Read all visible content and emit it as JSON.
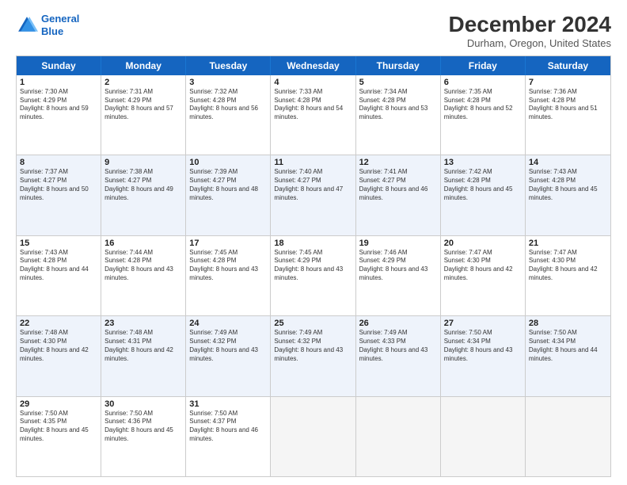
{
  "header": {
    "logo_line1": "General",
    "logo_line2": "Blue",
    "month_title": "December 2024",
    "location": "Durham, Oregon, United States"
  },
  "days_of_week": [
    "Sunday",
    "Monday",
    "Tuesday",
    "Wednesday",
    "Thursday",
    "Friday",
    "Saturday"
  ],
  "weeks": [
    [
      {
        "day": "1",
        "sunrise": "7:30 AM",
        "sunset": "4:29 PM",
        "daylight": "8 hours and 59 minutes."
      },
      {
        "day": "2",
        "sunrise": "7:31 AM",
        "sunset": "4:29 PM",
        "daylight": "8 hours and 57 minutes."
      },
      {
        "day": "3",
        "sunrise": "7:32 AM",
        "sunset": "4:28 PM",
        "daylight": "8 hours and 56 minutes."
      },
      {
        "day": "4",
        "sunrise": "7:33 AM",
        "sunset": "4:28 PM",
        "daylight": "8 hours and 54 minutes."
      },
      {
        "day": "5",
        "sunrise": "7:34 AM",
        "sunset": "4:28 PM",
        "daylight": "8 hours and 53 minutes."
      },
      {
        "day": "6",
        "sunrise": "7:35 AM",
        "sunset": "4:28 PM",
        "daylight": "8 hours and 52 minutes."
      },
      {
        "day": "7",
        "sunrise": "7:36 AM",
        "sunset": "4:28 PM",
        "daylight": "8 hours and 51 minutes."
      }
    ],
    [
      {
        "day": "8",
        "sunrise": "7:37 AM",
        "sunset": "4:27 PM",
        "daylight": "8 hours and 50 minutes."
      },
      {
        "day": "9",
        "sunrise": "7:38 AM",
        "sunset": "4:27 PM",
        "daylight": "8 hours and 49 minutes."
      },
      {
        "day": "10",
        "sunrise": "7:39 AM",
        "sunset": "4:27 PM",
        "daylight": "8 hours and 48 minutes."
      },
      {
        "day": "11",
        "sunrise": "7:40 AM",
        "sunset": "4:27 PM",
        "daylight": "8 hours and 47 minutes."
      },
      {
        "day": "12",
        "sunrise": "7:41 AM",
        "sunset": "4:27 PM",
        "daylight": "8 hours and 46 minutes."
      },
      {
        "day": "13",
        "sunrise": "7:42 AM",
        "sunset": "4:28 PM",
        "daylight": "8 hours and 45 minutes."
      },
      {
        "day": "14",
        "sunrise": "7:43 AM",
        "sunset": "4:28 PM",
        "daylight": "8 hours and 45 minutes."
      }
    ],
    [
      {
        "day": "15",
        "sunrise": "7:43 AM",
        "sunset": "4:28 PM",
        "daylight": "8 hours and 44 minutes."
      },
      {
        "day": "16",
        "sunrise": "7:44 AM",
        "sunset": "4:28 PM",
        "daylight": "8 hours and 43 minutes."
      },
      {
        "day": "17",
        "sunrise": "7:45 AM",
        "sunset": "4:28 PM",
        "daylight": "8 hours and 43 minutes."
      },
      {
        "day": "18",
        "sunrise": "7:45 AM",
        "sunset": "4:29 PM",
        "daylight": "8 hours and 43 minutes."
      },
      {
        "day": "19",
        "sunrise": "7:46 AM",
        "sunset": "4:29 PM",
        "daylight": "8 hours and 43 minutes."
      },
      {
        "day": "20",
        "sunrise": "7:47 AM",
        "sunset": "4:30 PM",
        "daylight": "8 hours and 42 minutes."
      },
      {
        "day": "21",
        "sunrise": "7:47 AM",
        "sunset": "4:30 PM",
        "daylight": "8 hours and 42 minutes."
      }
    ],
    [
      {
        "day": "22",
        "sunrise": "7:48 AM",
        "sunset": "4:30 PM",
        "daylight": "8 hours and 42 minutes."
      },
      {
        "day": "23",
        "sunrise": "7:48 AM",
        "sunset": "4:31 PM",
        "daylight": "8 hours and 42 minutes."
      },
      {
        "day": "24",
        "sunrise": "7:49 AM",
        "sunset": "4:32 PM",
        "daylight": "8 hours and 43 minutes."
      },
      {
        "day": "25",
        "sunrise": "7:49 AM",
        "sunset": "4:32 PM",
        "daylight": "8 hours and 43 minutes."
      },
      {
        "day": "26",
        "sunrise": "7:49 AM",
        "sunset": "4:33 PM",
        "daylight": "8 hours and 43 minutes."
      },
      {
        "day": "27",
        "sunrise": "7:50 AM",
        "sunset": "4:34 PM",
        "daylight": "8 hours and 43 minutes."
      },
      {
        "day": "28",
        "sunrise": "7:50 AM",
        "sunset": "4:34 PM",
        "daylight": "8 hours and 44 minutes."
      }
    ],
    [
      {
        "day": "29",
        "sunrise": "7:50 AM",
        "sunset": "4:35 PM",
        "daylight": "8 hours and 45 minutes."
      },
      {
        "day": "30",
        "sunrise": "7:50 AM",
        "sunset": "4:36 PM",
        "daylight": "8 hours and 45 minutes."
      },
      {
        "day": "31",
        "sunrise": "7:50 AM",
        "sunset": "4:37 PM",
        "daylight": "8 hours and 46 minutes."
      },
      null,
      null,
      null,
      null
    ]
  ]
}
